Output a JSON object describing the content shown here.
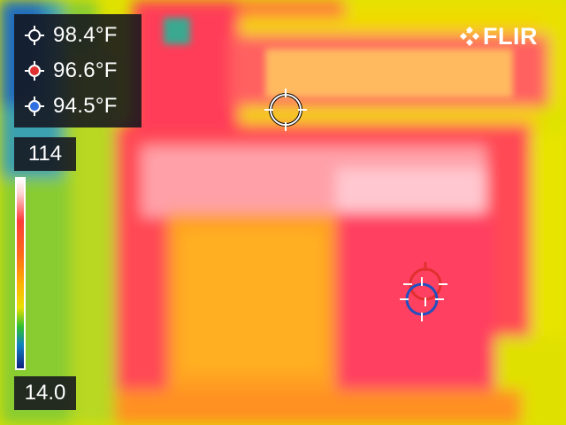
{
  "brand": {
    "name": "FLIR"
  },
  "measurements": [
    {
      "label": "98.4°F",
      "marker_color": "#ffffff",
      "marker_icon": "crosshair-white-icon"
    },
    {
      "label": "96.6°F",
      "marker_color": "#e03030",
      "marker_icon": "crosshair-red-icon"
    },
    {
      "label": "94.5°F",
      "marker_color": "#3070e0",
      "marker_icon": "crosshair-blue-icon"
    }
  ],
  "scale": {
    "max": "114",
    "min": "14.0"
  },
  "palette": {
    "hot": "#ff3b3b",
    "warm": "#ffb000",
    "cool": "#e8e000",
    "cold": "#1080c0"
  }
}
